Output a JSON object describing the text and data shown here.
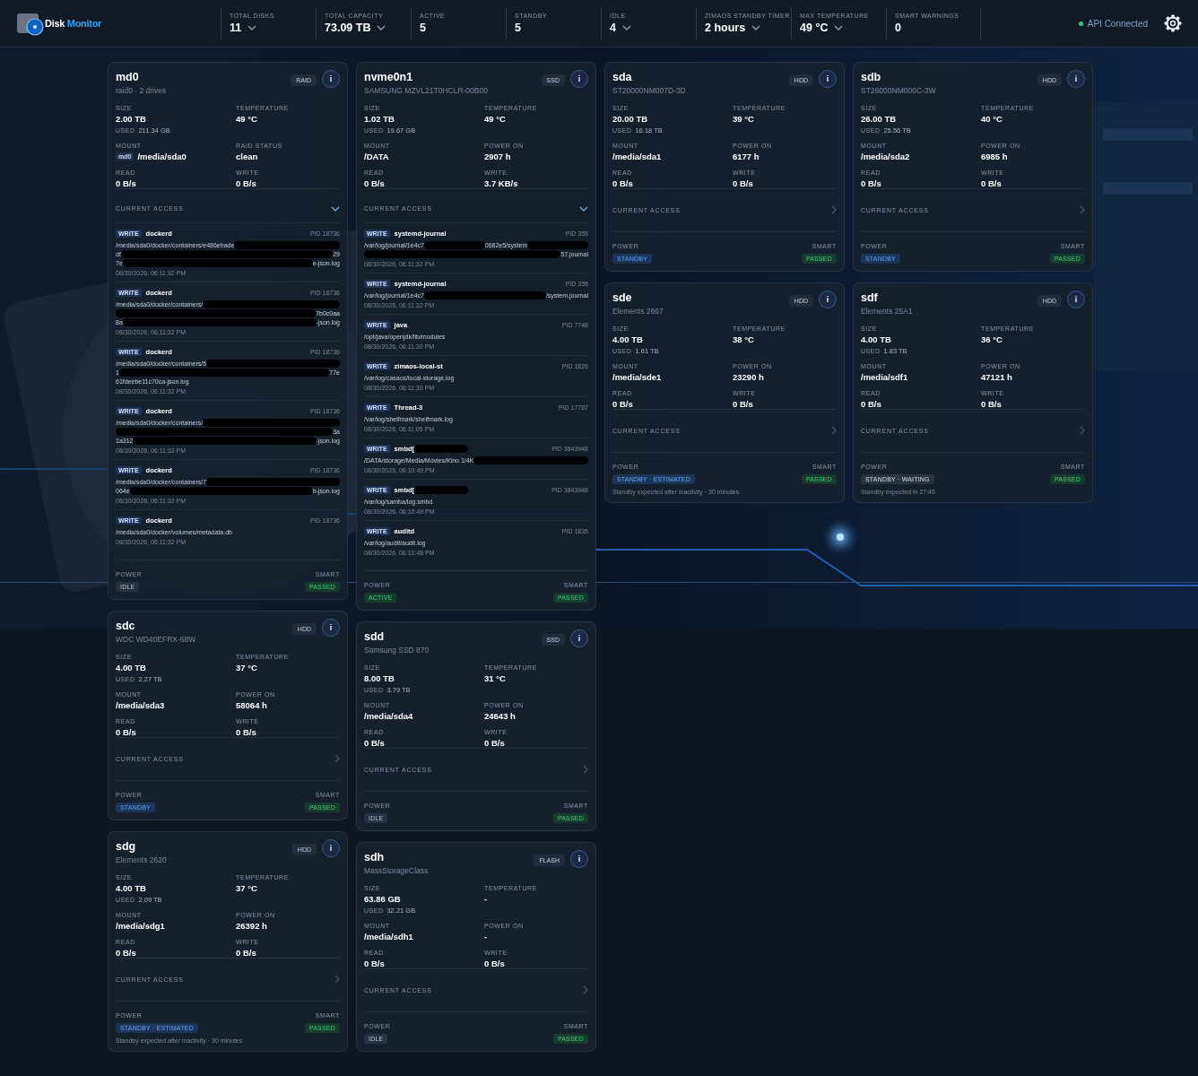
{
  "header": {
    "app_title": [
      "Disk",
      "Monitor"
    ],
    "stats": [
      {
        "label": "TOTAL DISKS",
        "value": "11",
        "dropdown": true
      },
      {
        "label": "TOTAL CAPACITY",
        "value": "73.09 TB",
        "dropdown": true
      },
      {
        "label": "ACTIVE",
        "value": "5",
        "dropdown": false
      },
      {
        "label": "STANDBY",
        "value": "5",
        "dropdown": false
      },
      {
        "label": "IDLE",
        "value": "4",
        "dropdown": true
      },
      {
        "label": "ZIMAOS STANDBY TIMER",
        "value": "2 hours",
        "dropdown": true
      },
      {
        "label": "MAX TEMPERATURE",
        "value": "49 °C",
        "dropdown": true
      },
      {
        "label": "SMART WARNINGS",
        "value": "0",
        "dropdown": false
      }
    ],
    "api_status": {
      "label": "API Connected",
      "connected": true
    }
  },
  "disks": [
    {
      "name": "md0",
      "model": "raid0 · 2 drives",
      "type": "RAID",
      "info": "i",
      "stats": [
        {
          "label": "SIZE",
          "value": "2.00 TB",
          "used_label": "USED",
          "used": "211.34 GB"
        },
        {
          "label": "TEMPERATURE",
          "value": "49 °C"
        },
        {
          "label": "MOUNT",
          "value": "/media/sda0",
          "tag": "md0"
        },
        {
          "label": "RAID STATUS",
          "value": "clean"
        },
        {
          "label": "READ",
          "value": "0 B/s"
        },
        {
          "label": "WRITE",
          "value": "0 B/s"
        }
      ],
      "access": {
        "label": "CURRENT ACCESS",
        "expanded": true,
        "entries": [
          {
            "op": "WRITE",
            "process": "dockerd",
            "pid": "PID 18736",
            "path": [
              {
                "parts": [
                  "/media/sda0/docker/containers/e486ebade"
                ],
                "redacted_after": true
              },
              {
                "parts": [
                  "df",
                  "29"
                ]
              },
              {
                "parts": [
                  "7e",
                  "e-json.log"
                ]
              }
            ],
            "time": "08/30/2026, 06:11:32 PM"
          },
          {
            "op": "WRITE",
            "process": "dockerd",
            "pid": "PID 18736",
            "path": [
              {
                "parts": [
                  "/media/sda0/docker/containers/"
                ],
                "redacted_after": true
              },
              {
                "parts": [
                  "7b0c0aa"
                ],
                "redacted_before": true
              },
              {
                "parts": [
                  "8a",
                  "-json.log"
                ]
              }
            ],
            "time": "08/30/2026, 06:11:32 PM"
          },
          {
            "op": "WRITE",
            "process": "dockerd",
            "pid": "PID 18736",
            "path": [
              {
                "parts": [
                  "/media/sda0/docker/containers/5"
                ],
                "redacted_after": true
              },
              {
                "parts": [
                  "1",
                  "77e"
                ]
              },
              {
                "parts": [
                  "61fdeebe11c70ca-json.log"
                ]
              }
            ],
            "time": "08/30/2026, 06:11:32 PM"
          },
          {
            "op": "WRITE",
            "process": "dockerd",
            "pid": "PID 18736",
            "path": [
              {
                "parts": [
                  "/media/sda0/docker/containers/"
                ],
                "redacted_after": true
              },
              {
                "parts": [
                  "3a"
                ],
                "redacted_before": true
              },
              {
                "parts": [
                  "1a312",
                  "-json.log"
                ]
              }
            ],
            "time": "08/30/2026, 06:11:32 PM"
          },
          {
            "op": "WRITE",
            "process": "dockerd",
            "pid": "PID 18736",
            "path": [
              {
                "parts": [
                  "/media/sda0/docker/containers/7"
                ],
                "redacted_after": true
              },
              {
                "parts": [
                  "064e",
                  "b-json.log"
                ]
              }
            ],
            "time": "08/30/2026, 06:11:32 PM"
          },
          {
            "op": "WRITE",
            "process": "dockerd",
            "pid": "PID 18736",
            "path": [
              {
                "parts": [
                  "/media/sda0/docker/volumes/metadata.db"
                ]
              }
            ],
            "time": "08/30/2026, 06:11:32 PM"
          }
        ]
      },
      "power": {
        "label": "POWER",
        "badge": "IDLE",
        "kind": "idle"
      },
      "smart": {
        "label": "SMART",
        "badge": "PASSED",
        "kind": "passed"
      }
    },
    {
      "name": "nvme0n1",
      "model": "SAMSUNG MZVL21T0HCLR-00B00",
      "type": "SSD",
      "info": "i",
      "stats": [
        {
          "label": "SIZE",
          "value": "1.02 TB",
          "used_label": "USED",
          "used": "19.67 GB"
        },
        {
          "label": "TEMPERATURE",
          "value": "49 °C"
        },
        {
          "label": "MOUNT",
          "value": "/DATA"
        },
        {
          "label": "POWER ON",
          "value": "2907 h"
        },
        {
          "label": "READ",
          "value": "0 B/s"
        },
        {
          "label": "WRITE",
          "value": "3.7 KB/s"
        }
      ],
      "access": {
        "label": "CURRENT ACCESS",
        "expanded": true,
        "entries": [
          {
            "op": "WRITE",
            "process": "systemd-journal",
            "pid": "PID 355",
            "path": [
              {
                "parts": [
                  "/var/log/journal/1e4c7",
                  "0682e5/system"
                ],
                "redacted_after": true
              },
              {
                "parts": [
                  "57.journal"
                ],
                "redacted_before": true
              }
            ],
            "time": "08/30/2026, 06:11:32 PM"
          },
          {
            "op": "WRITE",
            "process": "systemd-journal",
            "pid": "PID 355",
            "path": [
              {
                "parts": [
                  "/var/log/journal/1e4c7",
                  "/system.journal"
                ]
              }
            ],
            "time": "08/30/2026, 06:11:32 PM"
          },
          {
            "op": "WRITE",
            "process": "java",
            "pid": "PID 7748",
            "path": [
              {
                "parts": [
                  "/opt/java/openjdk/lib/modules"
                ]
              }
            ],
            "time": "08/30/2026, 06:11:30 PM"
          },
          {
            "op": "WRITE",
            "process": "zimaos-local-st",
            "pid": "PID 1826",
            "path": [
              {
                "parts": [
                  "/var/log/casaos/local-storage.log"
                ]
              }
            ],
            "time": "08/30/2026, 06:11:30 PM"
          },
          {
            "op": "WRITE",
            "process": "Thread-3",
            "pid": "PID 17787",
            "path": [
              {
                "parts": [
                  "/var/log/shelfmark/shelfmark.log"
                ]
              }
            ],
            "time": "08/30/2026, 06:11:05 PM"
          },
          {
            "op": "WRITE",
            "process": "smbd[",
            "process_redacted": true,
            "pid": "PID 3843948",
            "path": [
              {
                "parts": [
                  "/DATA/storage/Media/Movies/Kino 1/4K"
                ],
                "redacted_after": true
              }
            ],
            "time": "08/30/2026, 06:10:49 PM"
          },
          {
            "op": "WRITE",
            "process": "smbd[",
            "process_redacted": true,
            "pid": "PID 3843948",
            "path": [
              {
                "parts": [
                  "/var/log/samba/log.smbd"
                ]
              }
            ],
            "time": "08/30/2026, 06:10:49 PM"
          },
          {
            "op": "WRITE",
            "process": "auditd",
            "pid": "PID 1835",
            "path": [
              {
                "parts": [
                  "/var/log/audit/audit.log"
                ]
              }
            ],
            "time": "08/30/2026, 06:10:48 PM"
          }
        ]
      },
      "power": {
        "label": "POWER",
        "badge": "ACTIVE",
        "kind": "active"
      },
      "smart": {
        "label": "SMART",
        "badge": "PASSED",
        "kind": "passed"
      }
    },
    {
      "name": "sda",
      "model": "ST20000NM007D-3D",
      "type": "HDD",
      "info": "i",
      "stats": [
        {
          "label": "SIZE",
          "value": "20.00 TB",
          "used_label": "USED",
          "used": "16.18 TB"
        },
        {
          "label": "TEMPERATURE",
          "value": "39 °C"
        },
        {
          "label": "MOUNT",
          "value": "/media/sda1"
        },
        {
          "label": "POWER ON",
          "value": "6177 h"
        },
        {
          "label": "READ",
          "value": "0 B/s"
        },
        {
          "label": "WRITE",
          "value": "0 B/s"
        }
      ],
      "access": {
        "label": "CURRENT ACCESS",
        "expanded": false
      },
      "power": {
        "label": "POWER",
        "badge": "STANDBY",
        "kind": "standby"
      },
      "smart": {
        "label": "SMART",
        "badge": "PASSED",
        "kind": "passed"
      }
    },
    {
      "name": "sdb",
      "model": "ST26000NM000C-3W",
      "type": "HDD",
      "info": "i",
      "stats": [
        {
          "label": "SIZE",
          "value": "26.00 TB",
          "used_label": "USED",
          "used": "25.56 TB"
        },
        {
          "label": "TEMPERATURE",
          "value": "40 °C"
        },
        {
          "label": "MOUNT",
          "value": "/media/sda2"
        },
        {
          "label": "POWER ON",
          "value": "6985 h"
        },
        {
          "label": "READ",
          "value": "0 B/s"
        },
        {
          "label": "WRITE",
          "value": "0 B/s"
        }
      ],
      "access": {
        "label": "CURRENT ACCESS",
        "expanded": false
      },
      "power": {
        "label": "POWER",
        "badge": "STANDBY",
        "kind": "standby"
      },
      "smart": {
        "label": "SMART",
        "badge": "PASSED",
        "kind": "passed"
      }
    },
    {
      "name": "sdc",
      "model": "WDC WD40EFRX-68W",
      "type": "HDD",
      "info": "i",
      "stats": [
        {
          "label": "SIZE",
          "value": "4.00 TB",
          "used_label": "USED",
          "used": "2.27 TB"
        },
        {
          "label": "TEMPERATURE",
          "value": "37 °C"
        },
        {
          "label": "MOUNT",
          "value": "/media/sda3"
        },
        {
          "label": "POWER ON",
          "value": "58064 h"
        },
        {
          "label": "READ",
          "value": "0 B/s"
        },
        {
          "label": "WRITE",
          "value": "0 B/s"
        }
      ],
      "access": {
        "label": "CURRENT ACCESS",
        "expanded": false
      },
      "power": {
        "label": "POWER",
        "badge": "STANDBY",
        "kind": "standby"
      },
      "smart": {
        "label": "SMART",
        "badge": "PASSED",
        "kind": "passed"
      }
    },
    {
      "name": "sdd",
      "model": "Samsung SSD 870",
      "type": "SSD",
      "info": "i",
      "stats": [
        {
          "label": "SIZE",
          "value": "8.00 TB",
          "used_label": "USED",
          "used": "3.79 TB"
        },
        {
          "label": "TEMPERATURE",
          "value": "31 °C"
        },
        {
          "label": "MOUNT",
          "value": "/media/sda4"
        },
        {
          "label": "POWER ON",
          "value": "24643 h"
        },
        {
          "label": "READ",
          "value": "0 B/s"
        },
        {
          "label": "WRITE",
          "value": "0 B/s"
        }
      ],
      "access": {
        "label": "CURRENT ACCESS",
        "expanded": false
      },
      "power": {
        "label": "POWER",
        "badge": "IDLE",
        "kind": "idle"
      },
      "smart": {
        "label": "SMART",
        "badge": "PASSED",
        "kind": "passed"
      }
    },
    {
      "name": "sde",
      "model": "Elements 2667",
      "type": "HDD",
      "info": "i",
      "stats": [
        {
          "label": "SIZE",
          "value": "4.00 TB",
          "used_label": "USED",
          "used": "1.61 TB"
        },
        {
          "label": "TEMPERATURE",
          "value": "38 °C"
        },
        {
          "label": "MOUNT",
          "value": "/media/sde1"
        },
        {
          "label": "POWER ON",
          "value": "23290 h"
        },
        {
          "label": "READ",
          "value": "0 B/s"
        },
        {
          "label": "WRITE",
          "value": "0 B/s"
        }
      ],
      "access": {
        "label": "CURRENT ACCESS",
        "expanded": false
      },
      "power": {
        "label": "POWER",
        "badge": "STANDBY · ESTIMATED",
        "kind": "estimated",
        "note": "Standby expected after inactivity · 30 minutes"
      },
      "smart": {
        "label": "SMART",
        "badge": "PASSED",
        "kind": "passed"
      }
    },
    {
      "name": "sdf",
      "model": "Elements 25A1",
      "type": "HDD",
      "info": "i",
      "stats": [
        {
          "label": "SIZE",
          "value": "4.00 TB",
          "used_label": "USED",
          "used": "1.83 TB"
        },
        {
          "label": "TEMPERATURE",
          "value": "36 °C"
        },
        {
          "label": "MOUNT",
          "value": "/media/sdf1"
        },
        {
          "label": "POWER ON",
          "value": "47121 h"
        },
        {
          "label": "READ",
          "value": "0 B/s"
        },
        {
          "label": "WRITE",
          "value": "0 B/s"
        }
      ],
      "access": {
        "label": "CURRENT ACCESS",
        "expanded": false
      },
      "power": {
        "label": "POWER",
        "badge": "STANDBY · WAITING",
        "kind": "waiting",
        "note": "Standby expected in 27:45"
      },
      "smart": {
        "label": "SMART",
        "badge": "PASSED",
        "kind": "passed"
      }
    },
    {
      "name": "sdg",
      "model": "Elements 2620",
      "type": "HDD",
      "info": "i",
      "stats": [
        {
          "label": "SIZE",
          "value": "4.00 TB",
          "used_label": "USED",
          "used": "2.09 TB"
        },
        {
          "label": "TEMPERATURE",
          "value": "37 °C"
        },
        {
          "label": "MOUNT",
          "value": "/media/sdg1"
        },
        {
          "label": "POWER ON",
          "value": "26392 h"
        },
        {
          "label": "READ",
          "value": "0 B/s"
        },
        {
          "label": "WRITE",
          "value": "0 B/s"
        }
      ],
      "access": {
        "label": "CURRENT ACCESS",
        "expanded": false
      },
      "power": {
        "label": "POWER",
        "badge": "STANDBY · ESTIMATED",
        "kind": "estimated",
        "note": "Standby expected after inactivity · 30 minutes"
      },
      "smart": {
        "label": "SMART",
        "badge": "PASSED",
        "kind": "passed"
      }
    },
    {
      "name": "sdh",
      "model": "MassStorageClass",
      "type": "FLASH",
      "info": "i",
      "stats": [
        {
          "label": "SIZE",
          "value": "63.86 GB",
          "used_label": "USED",
          "used": "32.21 GB"
        },
        {
          "label": "TEMPERATURE",
          "value": "-"
        },
        {
          "label": "MOUNT",
          "value": "/media/sdh1"
        },
        {
          "label": "POWER ON",
          "value": "-"
        },
        {
          "label": "READ",
          "value": "0 B/s"
        },
        {
          "label": "WRITE",
          "value": "0 B/s"
        }
      ],
      "access": {
        "label": "CURRENT ACCESS",
        "expanded": false
      },
      "power": {
        "label": "POWER",
        "badge": "IDLE",
        "kind": "idle"
      },
      "smart": {
        "label": "SMART",
        "badge": "PASSED",
        "kind": "passed"
      }
    }
  ]
}
